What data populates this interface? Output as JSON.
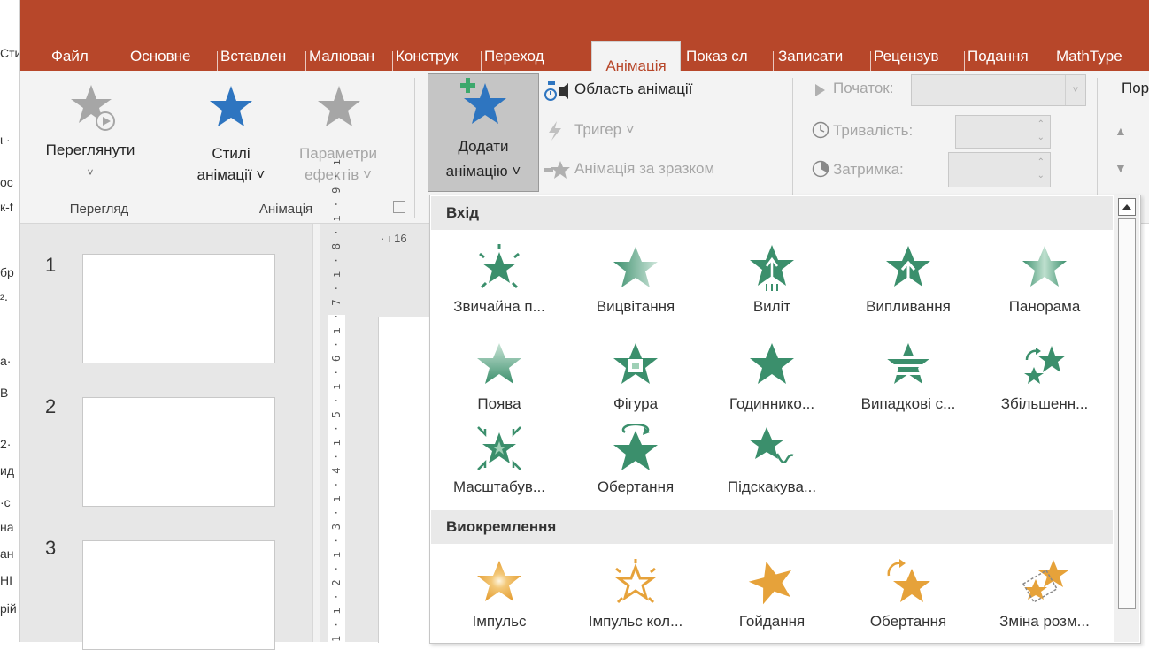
{
  "window": {
    "left_sliver": [
      "Сти",
      "ι ·",
      "ос",
      "к-f",
      "бр",
      "²·",
      "а·",
      "В",
      "2·",
      "ид",
      "·с",
      "на",
      "ан",
      "НІ",
      "рій"
    ]
  },
  "tabs": [
    "Файл",
    "Основне",
    "Вставлен",
    "Малюван",
    "Конструк",
    "Переход",
    "Анімація",
    "Показ сл",
    "Записати",
    "Рецензув",
    "Подання",
    "MathType"
  ],
  "active_tab": "Анімація",
  "ribbon": {
    "preview": {
      "label": "Переглянути",
      "chevron": "˅",
      "group": "Перегляд"
    },
    "styles": {
      "label1": "Стилі",
      "label2": "анімації ˅",
      "group": "Анімація"
    },
    "effect_options": {
      "label1": "Параметри",
      "label2": "ефектів ˅"
    },
    "add_animation": {
      "label1": "Додати",
      "label2": "анімацію ˅"
    },
    "animation_pane": "Область анімації",
    "trigger": "Тригер ˅",
    "animation_painter": "Анімація за зразком",
    "start_label": "Початок:",
    "duration_label": "Тривалість:",
    "delay_label": "Затримка:",
    "reorder_label": "Пор"
  },
  "slides": [
    "1",
    "2",
    "3"
  ],
  "ruler": {
    "h_fragment": "· ı 16",
    "v_marks": "1 · ı · 2 · ı · 3 · ı · 4 · ı · 5 · ı · 6 · ı · 7 · ı · 8 · ı · 9 · ı"
  },
  "gallery": {
    "sections": [
      {
        "title": "Вхід",
        "items": [
          {
            "label": "Звичайна п...",
            "icon": "appear-burst-star-icon",
            "color": "#3b8f6c"
          },
          {
            "label": "Вицвітання",
            "icon": "fade-star-icon",
            "color": "#3b8f6c"
          },
          {
            "label": "Виліт",
            "icon": "fly-in-star-icon",
            "color": "#3b8f6c"
          },
          {
            "label": "Випливання",
            "icon": "float-in-star-icon",
            "color": "#3b8f6c"
          },
          {
            "label": "Панорама",
            "icon": "split-star-icon",
            "color": "#3b8f6c"
          },
          {
            "label": "Поява",
            "icon": "wipe-star-icon",
            "color": "#3b8f6c"
          },
          {
            "label": "Фігура",
            "icon": "shape-star-icon",
            "color": "#3b8f6c"
          },
          {
            "label": "Годиннико...",
            "icon": "wheel-star-icon",
            "color": "#3b8f6c"
          },
          {
            "label": "Випадкові с...",
            "icon": "random-bars-star-icon",
            "color": "#3b8f6c"
          },
          {
            "label": "Збільшенн...",
            "icon": "grow-turn-star-icon",
            "color": "#3b8f6c"
          },
          {
            "label": "Масштабув...",
            "icon": "zoom-star-icon",
            "color": "#3b8f6c"
          },
          {
            "label": "Обертання",
            "icon": "swivel-star-icon",
            "color": "#3b8f6c"
          },
          {
            "label": "Підскакува...",
            "icon": "bounce-star-icon",
            "color": "#3b8f6c"
          }
        ]
      },
      {
        "title": "Виокремлення",
        "items": [
          {
            "label": "Імпульс",
            "icon": "pulse-star-icon",
            "color": "#e6a23a"
          },
          {
            "label": "Імпульс кол...",
            "icon": "color-pulse-star-icon",
            "color": "#e6a23a"
          },
          {
            "label": "Гойдання",
            "icon": "teeter-star-icon",
            "color": "#e6a23a"
          },
          {
            "label": "Обертання",
            "icon": "spin-star-icon",
            "color": "#e6a23a"
          },
          {
            "label": "Зміна розм...",
            "icon": "grow-shrink-star-icon",
            "color": "#e6a23a"
          }
        ]
      }
    ]
  },
  "colors": {
    "accent": "#b7472a",
    "entrance": "#3b8f6c",
    "emphasis": "#e6a23a",
    "blue_star": "#2e75c0",
    "grey_star": "#a6a6a6"
  }
}
